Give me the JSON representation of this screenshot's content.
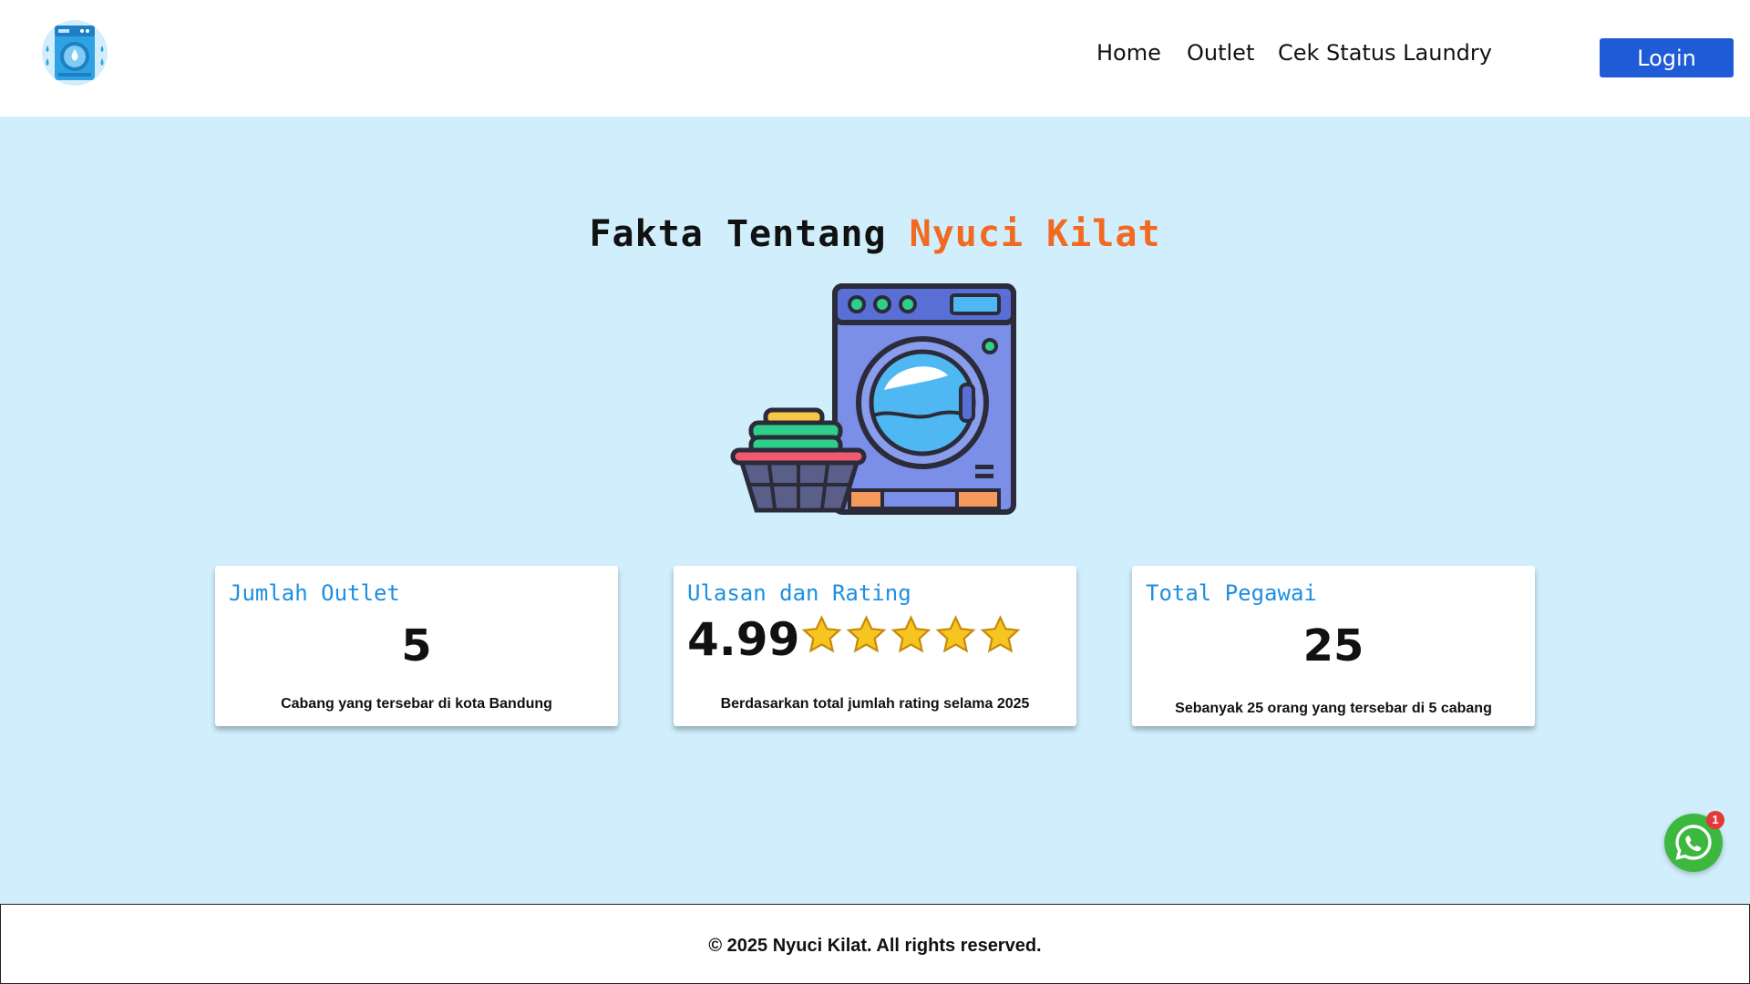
{
  "header": {
    "logo_icon": "washing-machine-logo-icon",
    "nav": [
      {
        "label": "Home"
      },
      {
        "label": "Outlet"
      },
      {
        "label": "Cek Status Laundry"
      }
    ],
    "login_label": "Login",
    "login_color": "#1f5bd6"
  },
  "facts": {
    "title_main": "Fakta Tentang ",
    "title_accent": "Nyuci Kilat",
    "accent_color": "#f26a21",
    "illustration_icon": "washing-machine-with-laundry-basket-illustration",
    "cards": [
      {
        "title": "Jumlah Outlet",
        "value": "5",
        "description": "Cabang yang tersebar di kota Bandung"
      },
      {
        "title": "Ulasan dan Rating",
        "value": "4.99",
        "stars": 5,
        "description": "Berdasarkan total jumlah rating selama 2025"
      },
      {
        "title": "Total Pegawai",
        "value": "25",
        "description": "Sebanyak 25 orang yang tersebar di 5 cabang"
      }
    ]
  },
  "whatsapp": {
    "icon": "whatsapp-icon",
    "badge_count": "1",
    "color": "#3cb83f"
  },
  "footer": {
    "text": "© 2025 Nyuci Kilat. All rights reserved."
  }
}
